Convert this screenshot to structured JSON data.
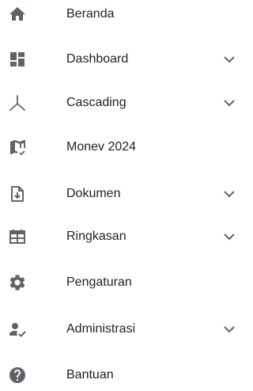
{
  "colors": {
    "icon": "#5f6368",
    "label": "#222222",
    "chevron": "#5f6368",
    "background": "#ffffff"
  },
  "menu": {
    "items": [
      {
        "label": "Beranda",
        "icon": "home-icon",
        "expandable": false
      },
      {
        "label": "Dashboard",
        "icon": "dashboard-icon",
        "expandable": true
      },
      {
        "label": "Cascading",
        "icon": "cascading-icon",
        "expandable": true
      },
      {
        "label": "Monev 2024",
        "icon": "map-check-icon",
        "expandable": false
      },
      {
        "label": "Dokumen",
        "icon": "document-download-icon",
        "expandable": true
      },
      {
        "label": "Ringkasan",
        "icon": "calendar-table-icon",
        "expandable": true
      },
      {
        "label": "Pengaturan",
        "icon": "gear-icon",
        "expandable": false
      },
      {
        "label": "Administrasi",
        "icon": "user-check-icon",
        "expandable": true
      },
      {
        "label": "Bantuan",
        "icon": "help-icon",
        "expandable": false
      }
    ]
  }
}
